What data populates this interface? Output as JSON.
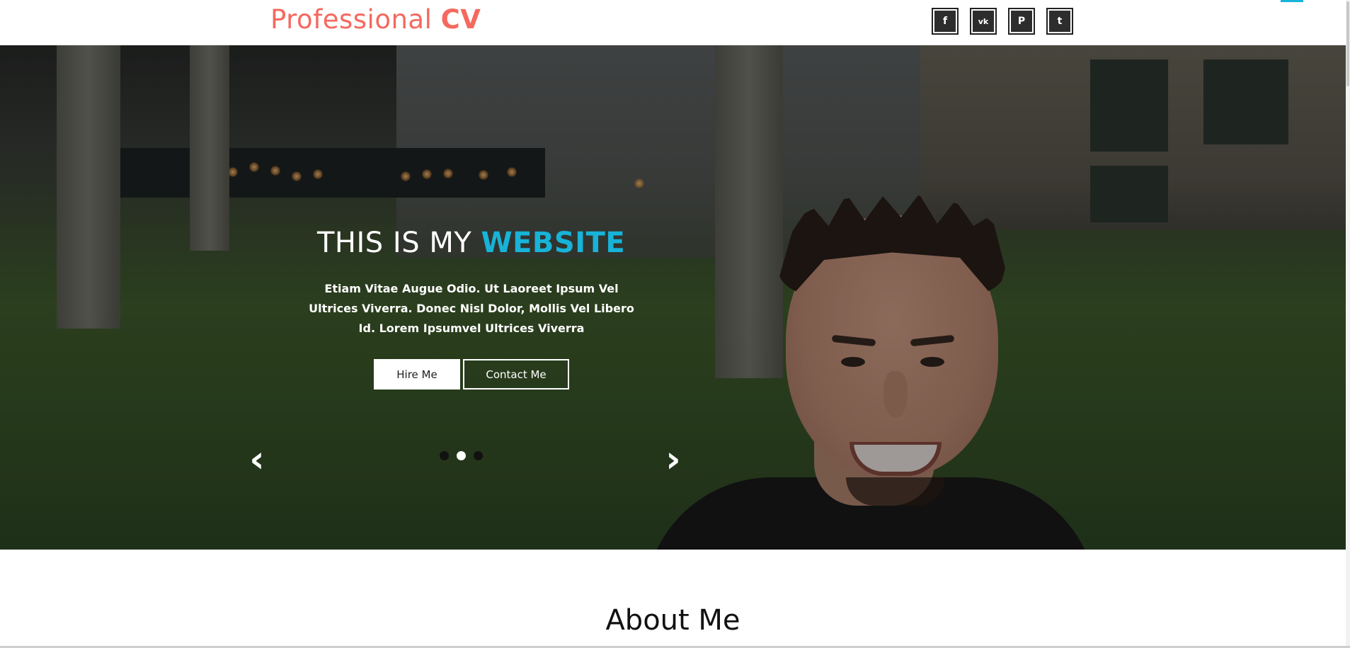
{
  "header": {
    "logo_text": "Professional",
    "logo_strong": "CV",
    "social": [
      {
        "icon": "facebook-icon",
        "glyph": "f"
      },
      {
        "icon": "vk-icon",
        "glyph": "vk"
      },
      {
        "icon": "pinterest-icon",
        "glyph": "P"
      },
      {
        "icon": "twitter-icon",
        "glyph": "t"
      }
    ]
  },
  "hero": {
    "title_plain": "THIS IS MY ",
    "title_accent": "WEBSITE",
    "description": "Etiam Vitae Augue Odio. Ut Laoreet Ipsum Vel Ultrices Viverra. Donec Nisl Dolor, Mollis Vel Libero Id. Lorem Ipsumvel Ultrices Viverra",
    "hire_button": "Hire Me",
    "contact_button": "Contact Me",
    "prev_glyph": "‹",
    "next_glyph": "›",
    "slide_count": 3,
    "active_slide": 2
  },
  "about": {
    "heading": "About Me"
  },
  "colors": {
    "brand": "#f5695e",
    "accent": "#17b3d8",
    "social_bg": "#2d2d2d"
  }
}
